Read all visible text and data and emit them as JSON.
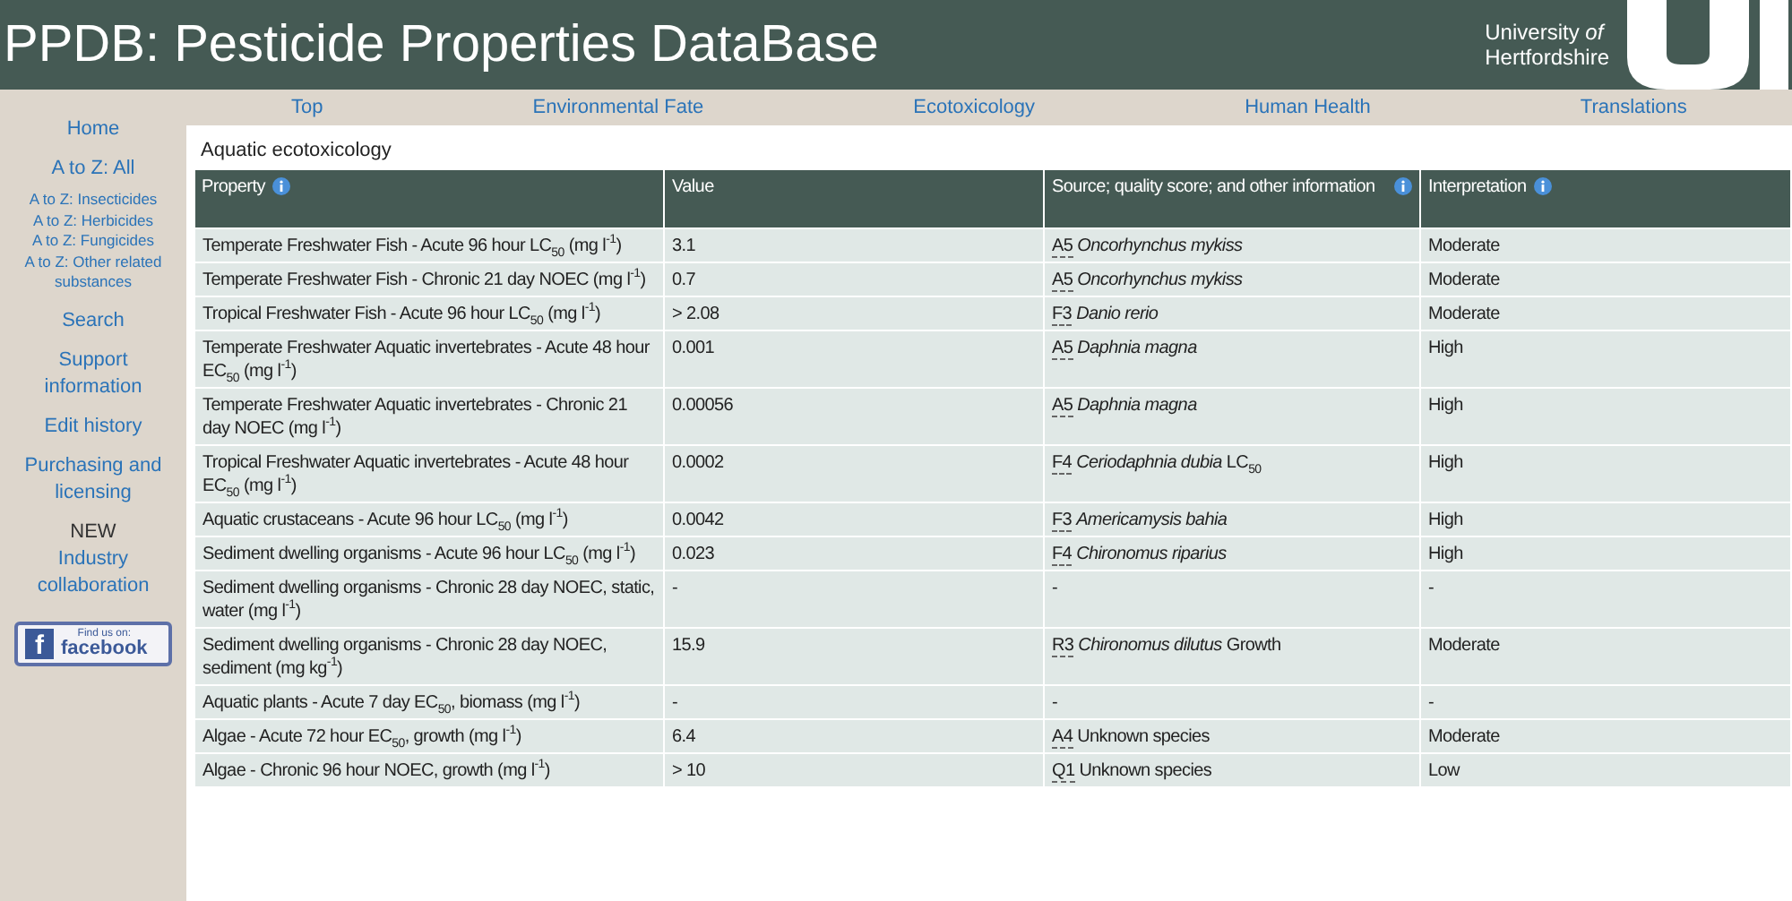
{
  "header": {
    "title": "PPDB: Pesticide Properties DataBase",
    "university": "University *of*",
    "university_line2": "Hertfordshire"
  },
  "top_nav": [
    "Top",
    "Environmental Fate",
    "Ecotoxicology",
    "Human Health",
    "Translations"
  ],
  "sidebar": {
    "items": [
      {
        "kind": "link",
        "label": "Home"
      },
      {
        "kind": "link",
        "label": "A to Z: All"
      },
      {
        "kind": "small_link",
        "label": "A to Z: Insecticides"
      },
      {
        "kind": "small_link",
        "label": "A to Z: Herbicides"
      },
      {
        "kind": "small_link",
        "label": "A to Z: Fungicides"
      },
      {
        "kind": "small_link",
        "label": "A to Z: Other related substances"
      },
      {
        "kind": "link",
        "label": "Search"
      },
      {
        "kind": "link",
        "label": "Support information"
      },
      {
        "kind": "link",
        "label": "Edit history"
      },
      {
        "kind": "link",
        "label": "Purchasing and licensing"
      },
      {
        "kind": "note",
        "label": "NEW"
      },
      {
        "kind": "link",
        "label": "Industry collaboration"
      }
    ],
    "facebook": {
      "glyph": "f",
      "caption": "Find us on:",
      "brand": "facebook"
    }
  },
  "section_title": "Aquatic ecotoxicology",
  "table": {
    "columns": [
      {
        "label": "Property",
        "info": true
      },
      {
        "label": "Value",
        "info": false
      },
      {
        "label": "Source; quality score; and other information",
        "info": true
      },
      {
        "label": "Interpretation",
        "info": true
      }
    ],
    "rows": [
      {
        "property": "Temperate Freshwater Fish - Acute 96 hour LC$_{50}$ (mg l$^{-1}$)",
        "value": "3.1",
        "code": "A5",
        "source": "*Oncorhynchus mykiss*",
        "interpretation": "Moderate"
      },
      {
        "property": "Temperate Freshwater Fish - Chronic 21 day NOEC (mg l$^{-1}$)",
        "value": "0.7",
        "code": "A5",
        "source": "*Oncorhynchus mykiss*",
        "interpretation": "Moderate"
      },
      {
        "property": "Tropical Freshwater Fish - Acute 96 hour LC$_{50}$ (mg l$^{-1}$)",
        "value": "> 2.08",
        "code": "F3",
        "source": "*Danio rerio*",
        "interpretation": "Moderate"
      },
      {
        "property": "Temperate Freshwater Aquatic invertebrates - Acute 48 hour EC$_{50}$ (mg l$^{-1}$)",
        "value": "0.001",
        "code": "A5",
        "source": "*Daphnia magna*",
        "interpretation": "High"
      },
      {
        "property": "Temperate Freshwater Aquatic invertebrates - Chronic 21 day NOEC (mg l$^{-1}$)",
        "value": "0.00056",
        "code": "A5",
        "source": "*Daphnia magna*",
        "interpretation": "High"
      },
      {
        "property": "Tropical Freshwater Aquatic invertebrates - Acute 48 hour EC$_{50}$ (mg l$^{-1}$)",
        "value": "0.0002",
        "code": "F4",
        "source": "*Ceriodaphnia dubia* LC$_{50}$",
        "interpretation": "High"
      },
      {
        "property": "Aquatic crustaceans - Acute 96 hour LC$_{50}$ (mg l$^{-1}$)",
        "value": "0.0042",
        "code": "F3",
        "source": "*Americamysis bahia*",
        "interpretation": "High"
      },
      {
        "property": "Sediment dwelling organisms - Acute 96 hour LC$_{50}$ (mg l$^{-1}$)",
        "value": "0.023",
        "code": "F4",
        "source": "*Chironomus riparius*",
        "interpretation": "High"
      },
      {
        "property": "Sediment dwelling organisms - Chronic 28 day NOEC, static, water (mg l$^{-1}$)",
        "value": "-",
        "source": "-",
        "interpretation": "-"
      },
      {
        "property": "Sediment dwelling organisms - Chronic 28 day NOEC, sediment (mg kg$^{-1}$)",
        "value": "15.9",
        "code": "R3",
        "source": "*Chironomus dilutus* Growth",
        "interpretation": "Moderate"
      },
      {
        "property": "Aquatic plants - Acute 7 day EC$_{50}$, biomass (mg l$^{-1}$)",
        "value": "-",
        "source": "-",
        "interpretation": "-"
      },
      {
        "property": "Algae - Acute 72 hour EC$_{50}$, growth (mg l$^{-1}$)",
        "value": "6.4",
        "code": "A4",
        "source": "Unknown species",
        "interpretation": "Moderate"
      },
      {
        "property": "Algae - Chronic 96 hour NOEC, growth (mg l$^{-1}$)",
        "value": "> 10",
        "code": "Q1",
        "source": "Unknown species",
        "interpretation": "Low"
      }
    ]
  }
}
